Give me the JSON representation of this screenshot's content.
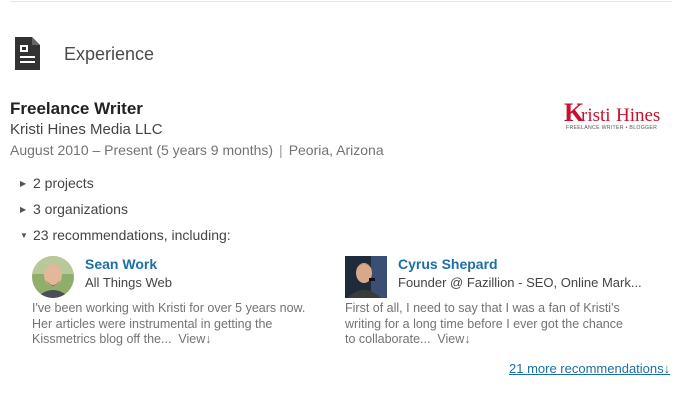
{
  "section": {
    "title": "Experience",
    "icon": "document-icon"
  },
  "job": {
    "title": "Freelance Writer",
    "company": "Kristi Hines Media LLC",
    "dates": "August 2010 – Present (5 years 9 months)",
    "separator": "|",
    "location": "Peoria, Arizona",
    "logo": {
      "brand": "KristiHines",
      "letter_k": "K",
      "name_rest": "risti",
      "name_last": "Hines",
      "tagline": "FREELANCE WRITER • BLOGGER"
    }
  },
  "expanders": {
    "projects": "2 projects",
    "organizations": "3 organizations",
    "recommendations": "23 recommendations, including:"
  },
  "recommendations": [
    {
      "name": "Sean Work",
      "headline": "All Things Web",
      "text_lines": [
        "I've been working with Kristi for over 5 years now.",
        "Her articles were instrumental in getting the",
        "Kissmetrics blog off the..."
      ],
      "view_label": "View↓"
    },
    {
      "name": "Cyrus Shepard",
      "headline": "Founder @ Fazillion - SEO, Online Mark...",
      "text_lines": [
        "First of all, I need to say that I was a fan of Kristi's",
        "writing for a long time before I ever got the chance",
        "to collaborate..."
      ],
      "view_label": "View↓"
    }
  ],
  "more_recommendations": "21 more recommendations↓",
  "colors": {
    "link": "#1b6fa8",
    "logo_red": "#c8102e",
    "text_muted": "#737373"
  }
}
